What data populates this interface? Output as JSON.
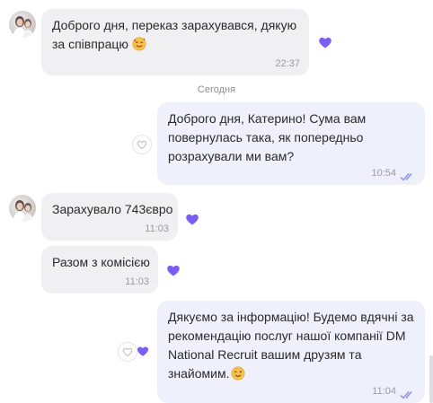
{
  "messages": [
    {
      "direction": "incoming",
      "lines": [
        "Доброго дня, переказ зарахувався, дякую",
        "за співпрацю"
      ],
      "emoji": "smiling-face-with-hearts",
      "time": "22:37",
      "reaction": "purple-heart"
    },
    {
      "direction": "outgoing",
      "lines": [
        "Доброго дня, Катерино! Сума вам",
        "повернулась така, як попередньо",
        "розрахували ми вам?"
      ],
      "time": "10:54",
      "status": "read"
    },
    {
      "direction": "incoming",
      "lines": [
        "Зарахувало 743євро"
      ],
      "time": "11:03",
      "reaction": "purple-heart"
    },
    {
      "direction": "incoming",
      "lines": [
        "Разом з комісією"
      ],
      "time": "11:03",
      "reaction": "purple-heart"
    },
    {
      "direction": "outgoing",
      "lines": [
        "Дякуємо за інформацію! Будемо вдячні за",
        "рекомендацію послуг нашої компанії DM",
        "National Recruit вашим друзям та",
        "знайомим."
      ],
      "emoji": "winking-face",
      "time": "11:04",
      "status": "read",
      "reaction": "purple-heart"
    }
  ],
  "date_separator": "Сегодня",
  "colors": {
    "incoming_bubble": "#f0f0f3",
    "outgoing_bubble": "#eef1fc",
    "heart": "#7b5cf5",
    "read_ticks": "#8a8df0"
  }
}
